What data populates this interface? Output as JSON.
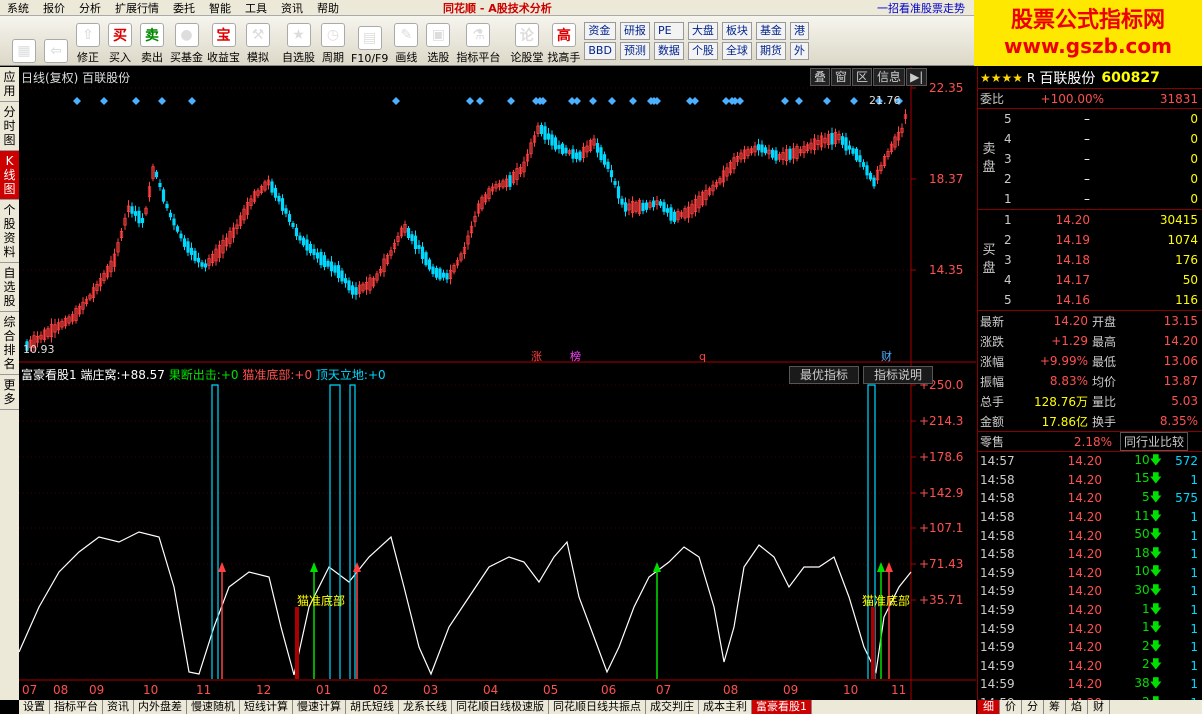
{
  "menu": [
    "系统",
    "报价",
    "分析",
    "扩展行情",
    "委托",
    "智能",
    "工具",
    "资讯",
    "帮助"
  ],
  "app_title": "同花顺 - A股技术分析",
  "menu_right": "一招看准股票走势",
  "logo": {
    "line1": "股票公式指标网",
    "line2": "www.gszb.com"
  },
  "toolbar": [
    {
      "label": "",
      "glyph": "▦",
      "name": "grid-icon"
    },
    {
      "label": "",
      "glyph": "⇦",
      "name": "back-arrow-icon"
    },
    {
      "label": "修正",
      "glyph": "⇧",
      "name": "correct-icon"
    },
    {
      "label": "买入",
      "glyph": "买",
      "name": "buy-icon"
    },
    {
      "label": "卖出",
      "glyph": "卖",
      "name": "sell-icon"
    },
    {
      "label": "买基金",
      "glyph": "●",
      "name": "fund-icon"
    },
    {
      "label": "收益宝",
      "glyph": "宝",
      "name": "treasure-icon"
    },
    {
      "label": "模拟",
      "glyph": "⚒",
      "name": "hammer-icon"
    },
    {
      "label": "自选股",
      "glyph": "★",
      "name": "star-icon"
    },
    {
      "label": "周期",
      "glyph": "◷",
      "name": "clock-icon"
    },
    {
      "label": "F10/F9",
      "glyph": "▤",
      "name": "f10-icon"
    },
    {
      "label": "画线",
      "glyph": "✎",
      "name": "pen-icon"
    },
    {
      "label": "选股",
      "glyph": "▣",
      "name": "select-stock-icon"
    },
    {
      "label": "指标平台",
      "glyph": "⚗",
      "name": "indicator-platform-icon"
    },
    {
      "label": "论股堂",
      "glyph": "论",
      "name": "forum-icon"
    },
    {
      "label": "找高手",
      "glyph": "高",
      "name": "expert-icon"
    }
  ],
  "toolbar_groups": [
    [
      "资金",
      "BBD"
    ],
    [
      "研报",
      "预测"
    ],
    [
      "PE",
      "数据"
    ],
    [
      "大盘",
      "个股"
    ],
    [
      "板块",
      "全球"
    ],
    [
      "基金",
      "期货"
    ],
    [
      "港",
      "外"
    ]
  ],
  "left_tabs": [
    "应用",
    "分时图",
    "K线图",
    "个股资料",
    "自选股",
    "综合排名",
    "更多"
  ],
  "k_title": "日线(复权) 百联股份",
  "k_buttons": [
    "叠",
    "窗",
    "区",
    "信息",
    "▶|"
  ],
  "price_axis": [
    "22.35",
    "18.37",
    "14.35"
  ],
  "high_label": "21.76",
  "low_label": "10.93",
  "event_markers": [
    "涨",
    "榜",
    "q",
    "财"
  ],
  "sub_title": {
    "name": "富豪看股1",
    "a_label": "端庄窝:",
    "a_val": "+88.57",
    "b_label": "果断出击:",
    "b_val": "+0",
    "c_label": "猫准底部:",
    "c_val": "+0",
    "d_label": "顶天立地:",
    "d_val": "+0"
  },
  "sub_buttons": [
    "最优指标",
    "指标说明"
  ],
  "sub_axis": [
    "+250.0",
    "+214.3",
    "+178.6",
    "+142.9",
    "+107.1",
    "+71.43",
    "+35.71"
  ],
  "ann_labels": [
    "猫准底部",
    "猫准底部"
  ],
  "month_axis": [
    "07",
    "08",
    "09",
    "10",
    "11",
    "12",
    "01",
    "02",
    "03",
    "04",
    "05",
    "06",
    "07",
    "08",
    "09",
    "10",
    "11"
  ],
  "bottom_tabs": [
    "设置",
    "指标平台",
    "资讯",
    "内外盘差",
    "慢速随机",
    "短线计算",
    "慢速计算",
    "胡氏短线",
    "龙系长线",
    "同花顺日线极速版",
    "同花顺日线共振点",
    "成交判庄",
    "成本主利",
    "富豪看股1"
  ],
  "quote": {
    "stars": "★★★★",
    "market": "R",
    "name": "百联股份",
    "code": "600827",
    "weibi_label": "委比",
    "weibi": "+100.00%",
    "weicha": "31831",
    "sell_label": "卖盘",
    "buy_label": "买盘",
    "sells": [
      {
        "lv": "5",
        "p": "–",
        "v": "0"
      },
      {
        "lv": "4",
        "p": "–",
        "v": "0"
      },
      {
        "lv": "3",
        "p": "–",
        "v": "0"
      },
      {
        "lv": "2",
        "p": "–",
        "v": "0"
      },
      {
        "lv": "1",
        "p": "–",
        "v": "0"
      }
    ],
    "buys": [
      {
        "lv": "1",
        "p": "14.20",
        "v": "30415"
      },
      {
        "lv": "2",
        "p": "14.19",
        "v": "1074"
      },
      {
        "lv": "3",
        "p": "14.18",
        "v": "176"
      },
      {
        "lv": "4",
        "p": "14.17",
        "v": "50"
      },
      {
        "lv": "5",
        "p": "14.16",
        "v": "116"
      }
    ],
    "stats": [
      [
        "最新",
        "14.20",
        "开盘",
        "13.15"
      ],
      [
        "涨跌",
        "+1.29",
        "最高",
        "14.20"
      ],
      [
        "涨幅",
        "+9.99%",
        "最低",
        "13.06"
      ],
      [
        "振幅",
        "8.83%",
        "均价",
        "13.87"
      ],
      [
        "总手",
        "128.76万",
        "量比",
        "5.03"
      ],
      [
        "金额",
        "17.86亿",
        "换手",
        "8.35%"
      ]
    ],
    "sell_tag": "零售",
    "sell_pct": "2.18%",
    "compare_btn": "同行业比较",
    "ticks": [
      [
        "14:57",
        "14.20",
        "10",
        "572"
      ],
      [
        "14:58",
        "14.20",
        "15",
        "1"
      ],
      [
        "14:58",
        "14.20",
        "5",
        "575"
      ],
      [
        "14:58",
        "14.20",
        "11",
        "1"
      ],
      [
        "14:58",
        "14.20",
        "50",
        "1"
      ],
      [
        "14:58",
        "14.20",
        "18",
        "1"
      ],
      [
        "14:59",
        "14.20",
        "10",
        "1"
      ],
      [
        "14:59",
        "14.20",
        "30",
        "1"
      ],
      [
        "14:59",
        "14.20",
        "1",
        "1"
      ],
      [
        "14:59",
        "14.20",
        "1",
        "1"
      ],
      [
        "14:59",
        "14.20",
        "2",
        "1"
      ],
      [
        "14:59",
        "14.20",
        "2",
        "1"
      ],
      [
        "14:59",
        "14.20",
        "38",
        "1"
      ],
      [
        "14:59",
        "14.20",
        "2",
        "1"
      ]
    ],
    "bottom_tabs": [
      "细",
      "价",
      "分",
      "筹",
      "焰",
      "财"
    ]
  }
}
